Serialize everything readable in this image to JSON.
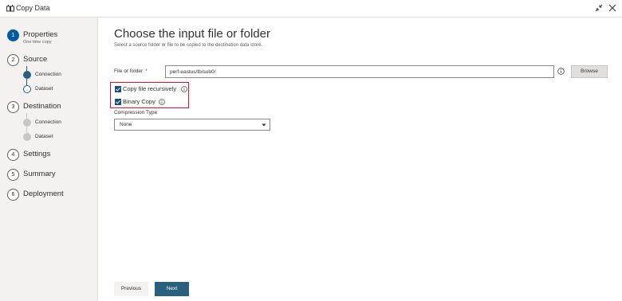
{
  "window": {
    "title": "Copy Data",
    "app_icon": "copy-data-icon",
    "collapse_icon": "collapse-icon",
    "close_icon": "close-icon"
  },
  "sidebar": {
    "steps": [
      {
        "number": "1",
        "label": "Properties",
        "sublabel": "One time copy",
        "active": true
      },
      {
        "number": "2",
        "label": "Source",
        "substeps": [
          "Connection",
          "Dataset"
        ]
      },
      {
        "number": "3",
        "label": "Destination",
        "substeps": [
          "Connection",
          "Dataset"
        ]
      },
      {
        "number": "4",
        "label": "Settings"
      },
      {
        "number": "5",
        "label": "Summary"
      },
      {
        "number": "6",
        "label": "Deployment"
      }
    ]
  },
  "main": {
    "title": "Choose the input file or folder",
    "subtitle": "Select a source folder or file to be copied to the destination data store.",
    "file_or_folder": {
      "label": "File or folder",
      "required_mark": "*",
      "value": "perf-eastus/tb/sub0/",
      "browse_label": "Browse"
    },
    "copy_recursively": {
      "label": "Copy file recursively",
      "checked": true
    },
    "binary_copy": {
      "label": "Binary Copy",
      "checked": true
    },
    "compression": {
      "label": "Compression Type",
      "selected": "None"
    },
    "buttons": {
      "previous": "Previous",
      "next": "Next"
    }
  },
  "colors": {
    "accent": "#2b5f7e",
    "active_step": "#005a9e",
    "highlight": "#e81123",
    "checkbox": "#1f4e79"
  }
}
